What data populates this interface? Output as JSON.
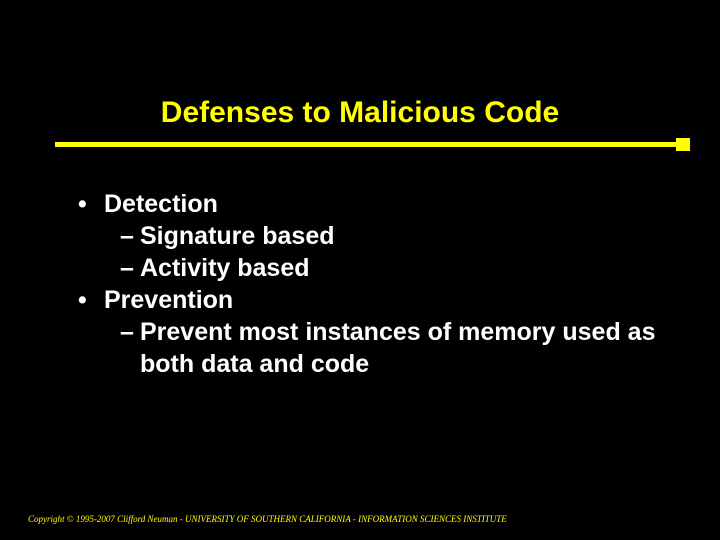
{
  "title": "Defenses to Malicious Code",
  "bullets": {
    "b1": {
      "marker": "•",
      "text": "Detection"
    },
    "b1_1": {
      "marker": "–",
      "text": "Signature based"
    },
    "b1_2": {
      "marker": "–",
      "text": "Activity based"
    },
    "b2": {
      "marker": "•",
      "text": "Prevention"
    },
    "b2_1": {
      "marker": "–",
      "text": "Prevent most instances of memory used as both data and code"
    }
  },
  "footer": "Copyright © 1995-2007 Clifford Neuman - UNIVERSITY OF SOUTHERN CALIFORNIA - INFORMATION SCIENCES INSTITUTE"
}
